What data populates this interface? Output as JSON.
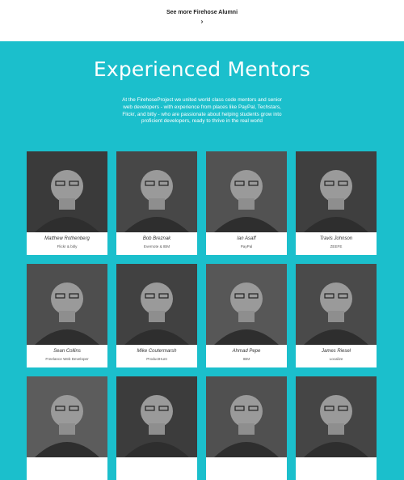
{
  "alumni": {
    "see_more": "See more Firehose Alumni",
    "chevron": "›"
  },
  "mentors": {
    "title": "Experienced Mentors",
    "intro": "At the FirehoseProject we united world class code mentors and senior web developers - with experience from places like PayPal, Techstars, Flickr, and bitly - who are passionate about helping students grow into proficient developers, ready to thrive in the real world",
    "cards": [
      {
        "name": "Matthew Rothenberg",
        "company": "Flickr & bitly"
      },
      {
        "name": "Bob Breznak",
        "company": "Evernote & IBM"
      },
      {
        "name": "Ian Asaff",
        "company": "PayPal"
      },
      {
        "name": "Travis Johnson",
        "company": "ZEEFE"
      },
      {
        "name": "Sean Collins",
        "company": "Freelance Web Developer"
      },
      {
        "name": "Mike Coutermarsh",
        "company": "ProductHunt"
      },
      {
        "name": "Ahmad Pepe",
        "company": "IBM"
      },
      {
        "name": "James Riesel",
        "company": "Localize"
      },
      {
        "name": "",
        "company": ""
      },
      {
        "name": "",
        "company": ""
      },
      {
        "name": "",
        "company": ""
      },
      {
        "name": "",
        "company": ""
      }
    ]
  },
  "colors": {
    "accent": "#1bbfcc",
    "card": "#ffffff",
    "photo": "#4b4b4b"
  }
}
